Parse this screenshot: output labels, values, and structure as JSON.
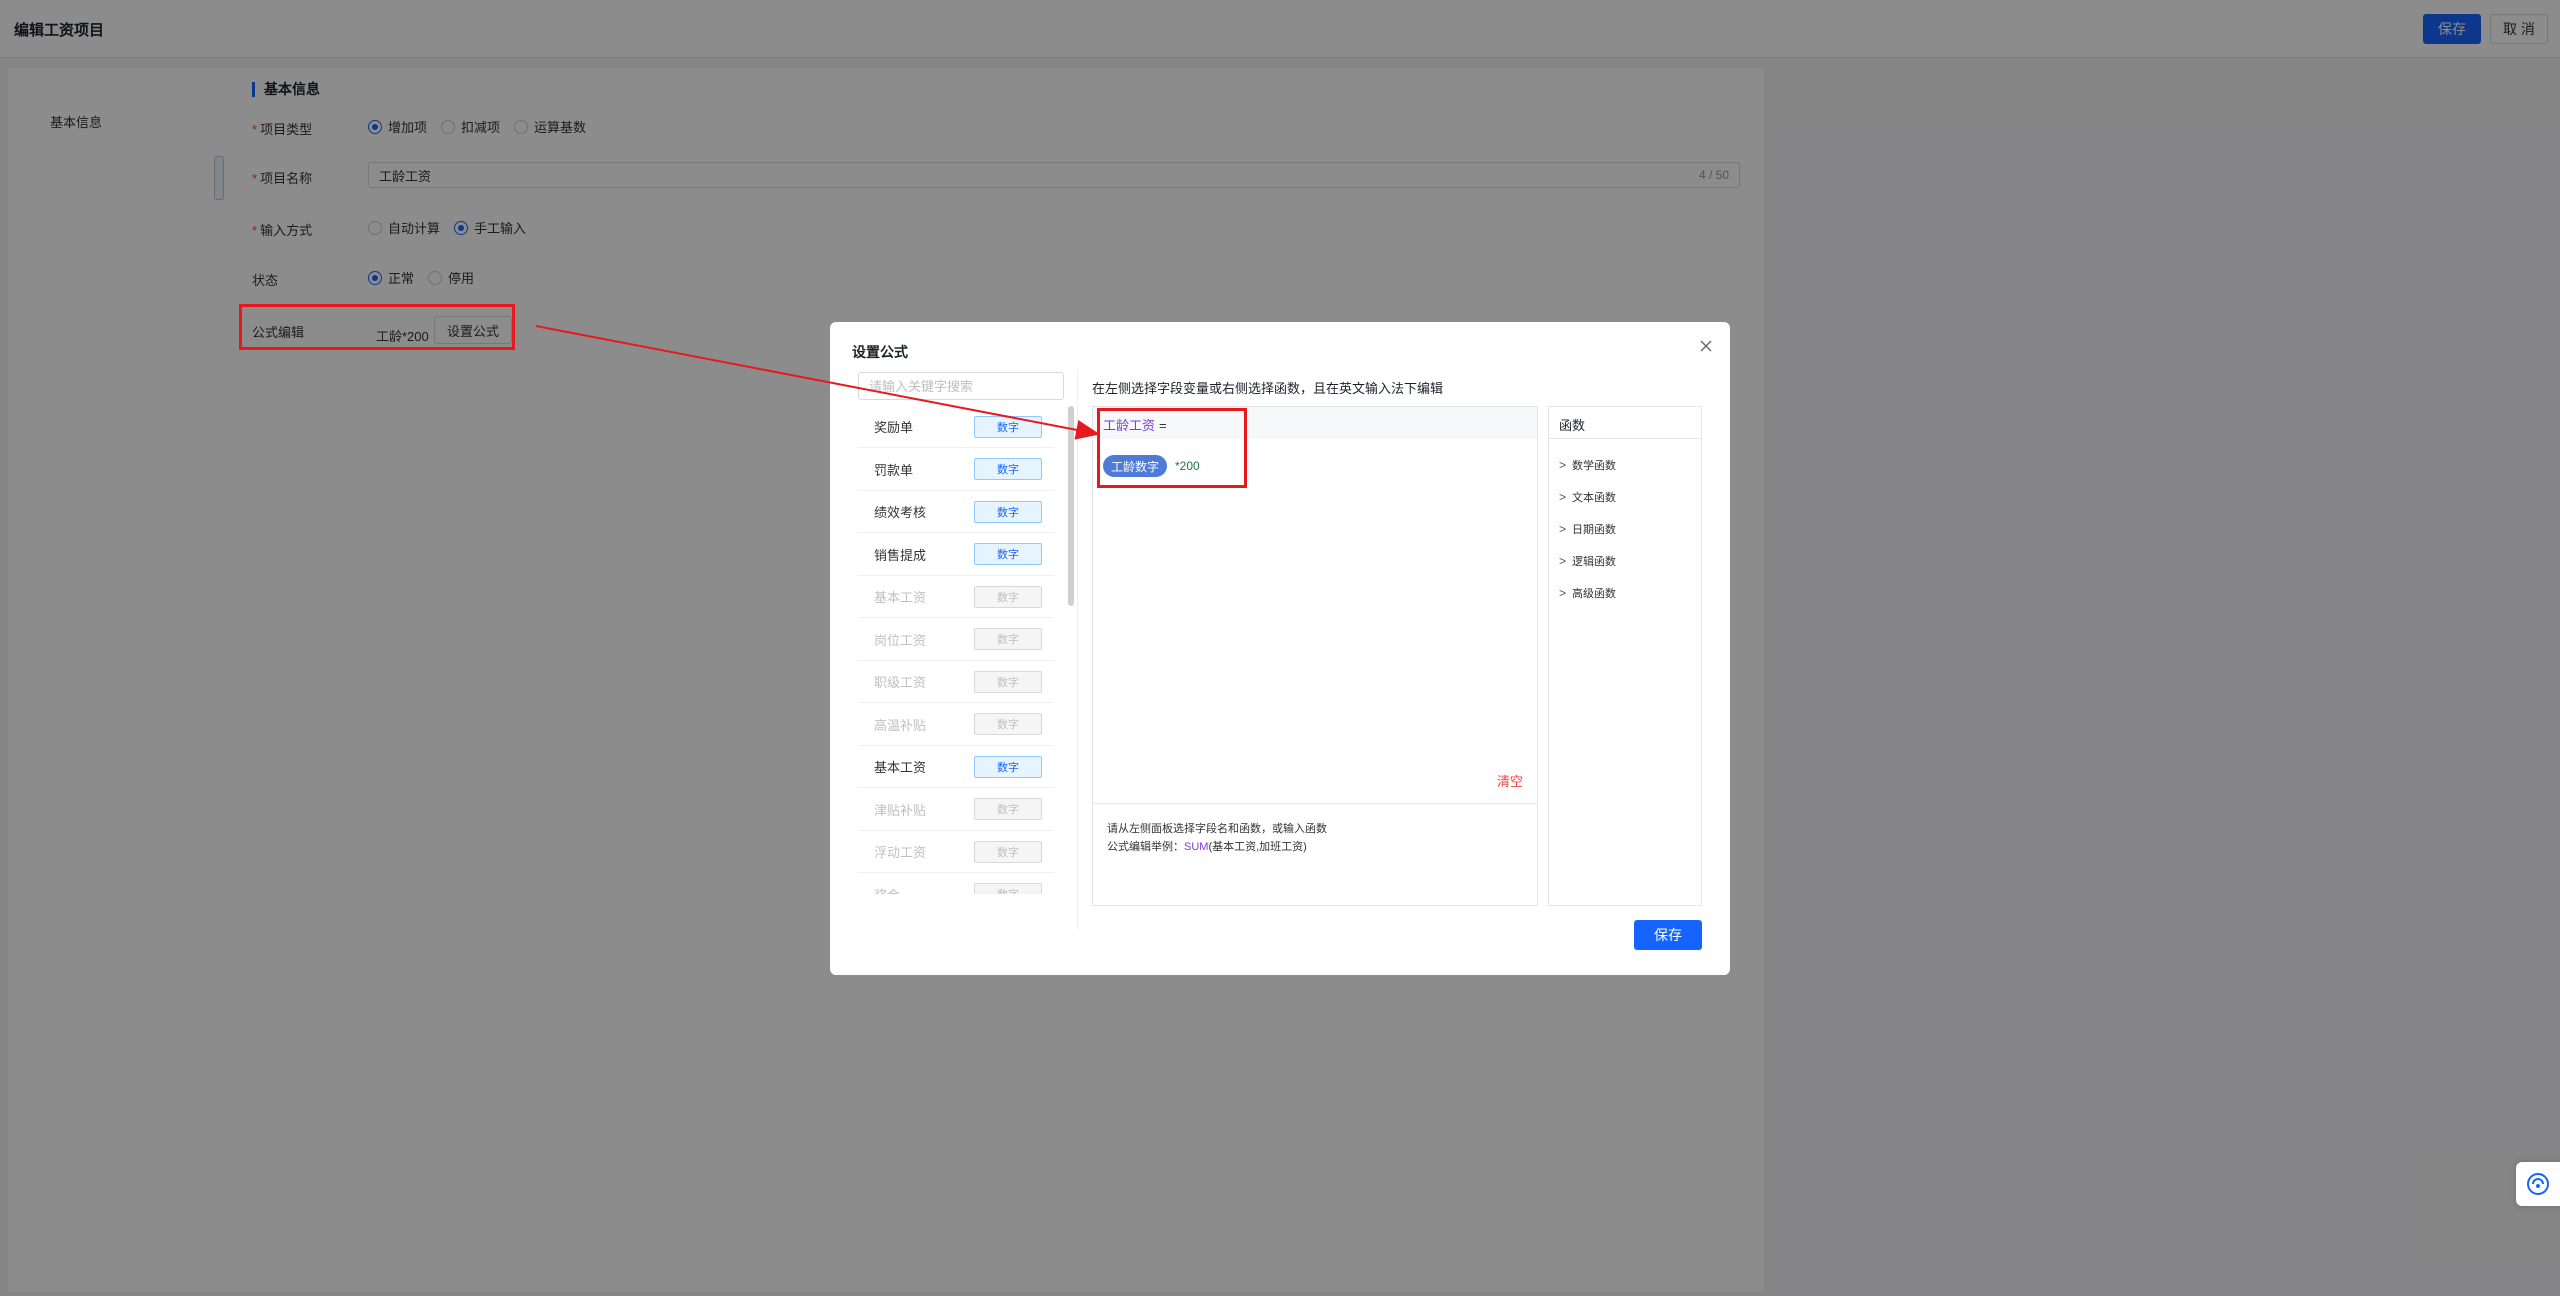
{
  "header": {
    "title": "编辑工资项目",
    "save_label": "保存",
    "cancel_label": "取 消"
  },
  "sidebar": {
    "items": [
      {
        "label": "基本信息"
      }
    ]
  },
  "form": {
    "section_title": "基本信息",
    "item_type": {
      "label": "项目类型",
      "options": [
        {
          "label": "增加项",
          "checked": true
        },
        {
          "label": "扣减项",
          "checked": false
        },
        {
          "label": "运算基数",
          "checked": false
        }
      ]
    },
    "item_name": {
      "label": "项目名称",
      "value": "工龄工资",
      "counter": "4 / 50"
    },
    "input_method": {
      "label": "输入方式",
      "options": [
        {
          "label": "自动计算",
          "checked": false
        },
        {
          "label": "手工输入",
          "checked": true
        }
      ]
    },
    "status": {
      "label": "状态",
      "options": [
        {
          "label": "正常",
          "checked": true
        },
        {
          "label": "停用",
          "checked": false
        }
      ]
    },
    "formula": {
      "label": "公式编辑",
      "value": "工龄*200",
      "button_label": "设置公式"
    }
  },
  "dialog": {
    "title": "设置公式",
    "search_placeholder": "请输入关键字搜索",
    "fields": [
      {
        "name": "奖励单",
        "tag": "数字",
        "enabled": true
      },
      {
        "name": "罚款单",
        "tag": "数字",
        "enabled": true
      },
      {
        "name": "绩效考核",
        "tag": "数字",
        "enabled": true
      },
      {
        "name": "销售提成",
        "tag": "数字",
        "enabled": true
      },
      {
        "name": "基本工资",
        "tag": "数字",
        "enabled": false
      },
      {
        "name": "岗位工资",
        "tag": "数字",
        "enabled": false
      },
      {
        "name": "职级工资",
        "tag": "数字",
        "enabled": false
      },
      {
        "name": "高温补贴",
        "tag": "数字",
        "enabled": false
      },
      {
        "name": "基本工资",
        "tag": "数字",
        "enabled": true
      },
      {
        "name": "津贴补贴",
        "tag": "数字",
        "enabled": false
      },
      {
        "name": "浮动工资",
        "tag": "数字",
        "enabled": false
      },
      {
        "name": "奖金",
        "tag": "数字",
        "enabled": false
      }
    ],
    "hint": "在左侧选择字段变量或右侧选择函数，且在英文输入法下编辑",
    "editor": {
      "target": "工龄工资",
      "equals": "=",
      "chip": "工龄数字",
      "expression": "*200",
      "clear_label": "清空",
      "help_line1": "请从左侧面板选择字段名和函数，或输入函数",
      "help_line2_prefix": "公式编辑举例：",
      "help_line2_func": "SUM",
      "help_line2_args": "(基本工资,加班工资)"
    },
    "functions": {
      "header": "函数",
      "items": [
        "数学函数",
        "文本函数",
        "日期函数",
        "逻辑函数",
        "高级函数"
      ]
    },
    "save_label": "保存"
  },
  "colors": {
    "primary": "#1664ff",
    "annotation": "#e8191d",
    "variable": "#7a3ae5",
    "danger": "#f53f3f"
  }
}
